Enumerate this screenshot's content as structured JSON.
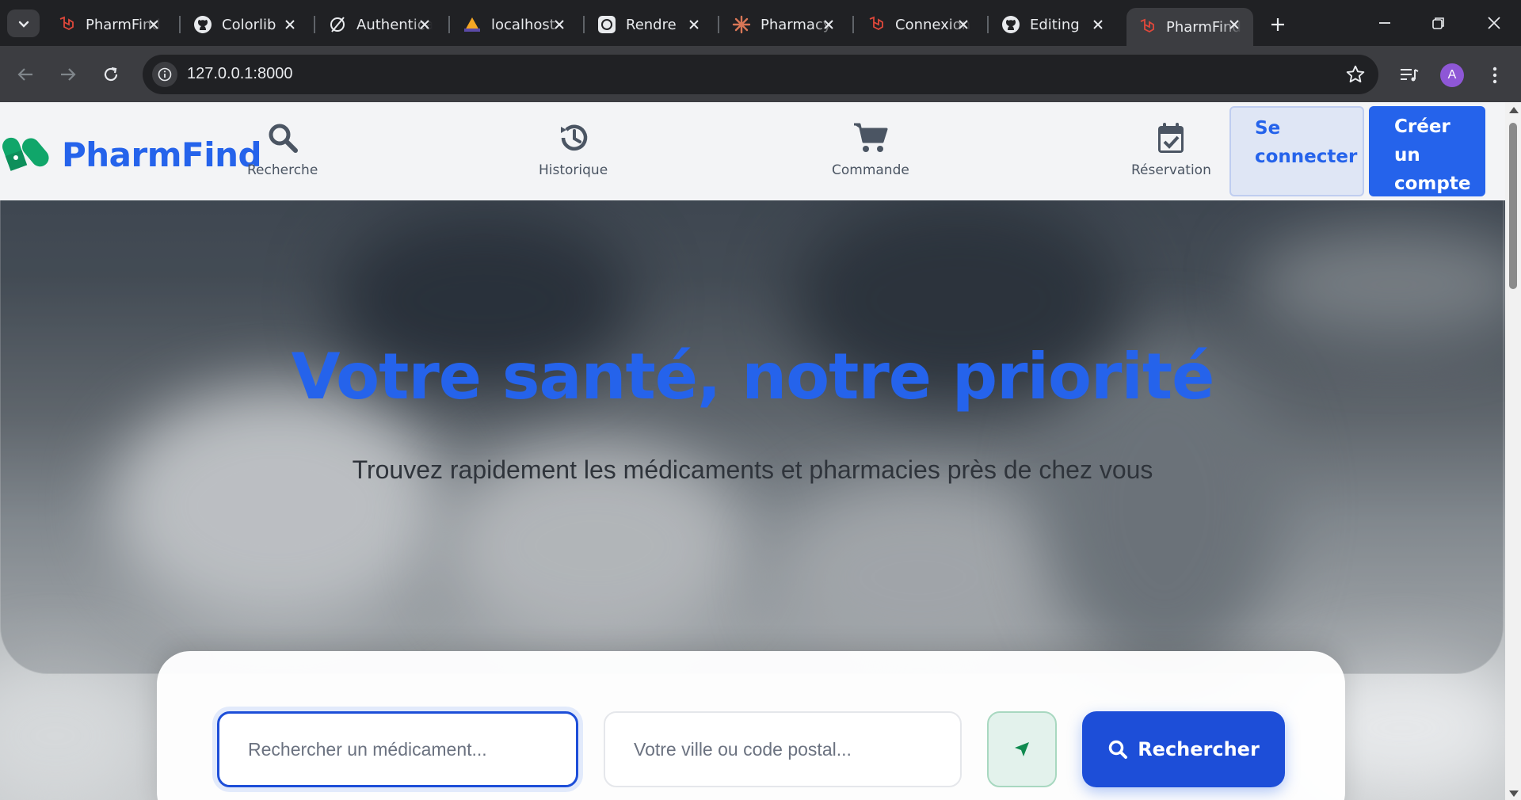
{
  "browser": {
    "tabs": [
      {
        "title": "PharmFind",
        "icon": "laravel-icon"
      },
      {
        "title": "Colorlib",
        "icon": "github-icon"
      },
      {
        "title": "Authentication",
        "icon": "slash-icon"
      },
      {
        "title": "localhost",
        "icon": "site-icon"
      },
      {
        "title": "Rendre",
        "icon": "openai-icon"
      },
      {
        "title": "Pharmacy",
        "icon": "claude-icon"
      },
      {
        "title": "Connexion",
        "icon": "laravel-icon"
      },
      {
        "title": "Editing",
        "icon": "github-icon"
      },
      {
        "title": "PharmFind",
        "icon": "laravel-icon",
        "active": true
      }
    ],
    "url": "127.0.0.1:8000",
    "profile_initial": "A"
  },
  "site": {
    "brand": "PharmFind",
    "brand_color": "#2563eb",
    "nav": [
      {
        "label": "Recherche",
        "icon": "search-icon"
      },
      {
        "label": "Historique",
        "icon": "history-icon"
      },
      {
        "label": "Commande",
        "icon": "cart-icon"
      },
      {
        "label": "Réservation",
        "icon": "calendar-check-icon"
      }
    ],
    "login_label": "Se connecter",
    "signup_label": "Créer un compte"
  },
  "hero": {
    "title": "Votre santé, notre priorité",
    "subtitle": "Trouvez rapidement les médicaments et pharmacies près de chez vous"
  },
  "search": {
    "medicine_placeholder": "Rechercher un médicament...",
    "city_placeholder": "Votre ville ou code postal...",
    "button_label": "Rechercher"
  }
}
